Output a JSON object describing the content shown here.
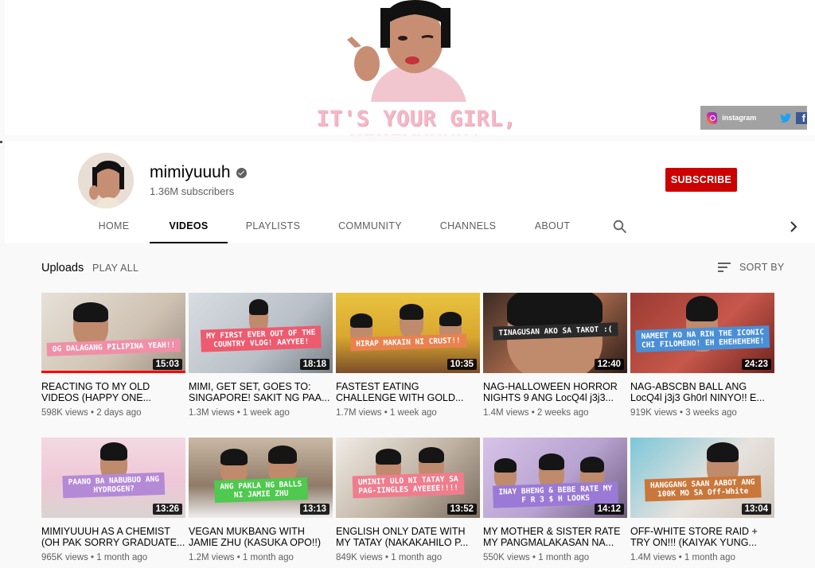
{
  "banner": {
    "tagline": "IT'S YOUR GIRL, MIMIYUUUH!",
    "social": {
      "instagram_label": "instagram",
      "facebook_glyph": "f",
      "bg_color": "#a2a2a2"
    }
  },
  "channel": {
    "name": "mimiyuuuh",
    "subscribers": "1.36M subscribers",
    "subscribe_label": "SUBSCRIBE",
    "subscribe_color": "#cc0000"
  },
  "tabs": [
    "HOME",
    "VIDEOS",
    "PLAYLISTS",
    "COMMUNITY",
    "CHANNELS",
    "ABOUT"
  ],
  "active_tab": "VIDEOS",
  "icons": {
    "search": "search-icon",
    "next": "chevron-right-icon",
    "sort": "sort-icon",
    "verified": "verified-icon"
  },
  "uploads": {
    "title": "Uploads",
    "play_all": "PLAY ALL",
    "sort_by": "SORT BY",
    "videos": [
      {
        "title": "REACTING TO MY OLD VIDEOS (HAPPY ONE...",
        "meta": "598K views • 2 days ago",
        "duration": "15:03",
        "caption": "OG DALAGANG PILIPINA YEAH!!",
        "caption_color": "#f08fa8",
        "watched": 1.0
      },
      {
        "title": "MIMI, GET SET, GOES TO: SINGAPORE! SAKIT NG PAA...",
        "meta": "1.3M views • 1 week ago",
        "duration": "18:18",
        "caption": "MY FIRST EVER OUT OF THE\nCOUNTRY VLOG! AAYYEE!",
        "caption_color": "#ee5a6f"
      },
      {
        "title": "FASTEST EATING CHALLENGE WITH GOLD...",
        "meta": "1.7M views • 1 week ago",
        "duration": "10:35",
        "caption": "HIRAP MAKAIN NI CRUST!!",
        "caption_color": "#e9824f"
      },
      {
        "title": "NAG-HALLOWEEN HORROR NIGHTS 9 ANG LocQ4l j3j3...",
        "meta": "1.4M views • 2 weeks ago",
        "duration": "12:40",
        "caption": "TINAGUSAN AKO SA TAKOT :(",
        "caption_color": "#2a2a2a"
      },
      {
        "title": "NAG-ABSCBN BALL ANG LocQ4l j3j3 Gh0rl NINYO!! E...",
        "meta": "919K views • 3 weeks ago",
        "duration": "24:23",
        "caption": "NAMEET KO NA RIN THE ICONIC\nCHI FILOMENO! EH EHEHEHEHE!",
        "caption_color": "#4a8fd6"
      },
      {
        "title": "MIMIYUUUH AS A CHEMIST (OH PAK SORRY GRADUATE...",
        "meta": "965K views • 1 month ago",
        "duration": "13:26",
        "caption": "PAANO BA NABUBUO ANG\nHYDROGEN?",
        "caption_color": "#b48ad6"
      },
      {
        "title": "VEGAN MUKBANG WITH JAMIE ZHU (KASUKA OPO!!)",
        "meta": "1.2M views • 1 month ago",
        "duration": "13:13",
        "caption": "ANG PAKLA NG BALLS\nNI JAMIE ZHU",
        "caption_color": "#4fc94f"
      },
      {
        "title": "ENGLISH ONLY DATE WITH MY TATAY (NAKAKAHILO P...",
        "meta": "849K views • 1 month ago",
        "duration": "13:52",
        "caption": "UMINIT ULO NI TATAY SA\nPAG-IINGLES AYEEEE!!!!",
        "caption_color": "#ef7d8e"
      },
      {
        "title": "MY MOTHER & SISTER RATE MY PANGMALAKASAN NA...",
        "meta": "550K views • 1 month ago",
        "duration": "14:12",
        "caption": "INAY BHENG & BEBE RATE MY\nF R 3 $ H LOOKS",
        "caption_color": "#9a7ad6"
      },
      {
        "title": "OFF-WHITE STORE RAID + TRY ON!!! (KAIYAK YUNG...",
        "meta": "1.4M views • 1 month ago",
        "duration": "13:04",
        "caption": "HANGGANG SAAN AABOT ANG\n100K MO SA Off-White",
        "caption_color": "#c9773a"
      }
    ]
  }
}
